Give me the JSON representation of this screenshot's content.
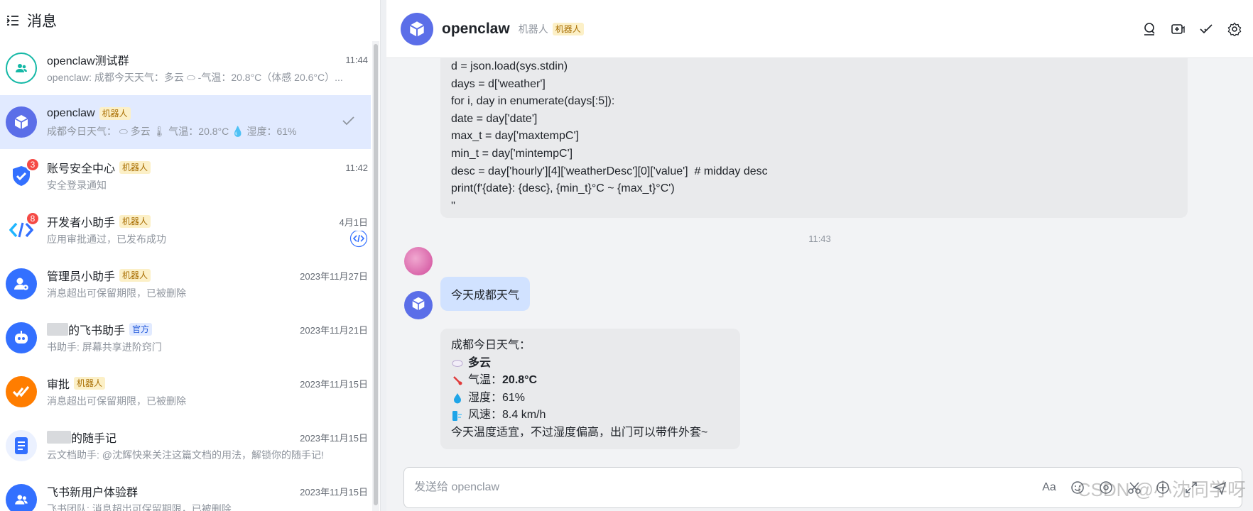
{
  "sidebar": {
    "title": "消息",
    "chats": [
      {
        "name": "openclaw测试群",
        "time": "11:44",
        "preview": "openclaw: 成都今天天气：多云 ⬭ -气温：20.8°C（体感 20.6°C）...",
        "avatar_color": "#14b8a6",
        "icon": "group-icon"
      },
      {
        "name": "openclaw",
        "tag": "机器人",
        "preview": "成都今日天气： ⬭ 多云 🌡 气温：20.8°C 💧 湿度：61%",
        "avatar_color": "#5b6ee8",
        "icon": "cube-icon",
        "active": true
      },
      {
        "name": "账号安全中心",
        "tag": "机器人",
        "time": "11:42",
        "preview": "安全登录通知",
        "badge": "3",
        "avatar_color": "#3370ff",
        "icon": "shield-icon"
      },
      {
        "name": "开发者小助手",
        "tag": "机器人",
        "time": "4月1日",
        "preview": "应用审批通过，已发布成功",
        "badge": "8",
        "avatar_color": "#ffffff",
        "icon": "code-icon"
      },
      {
        "name": "管理员小助手",
        "tag": "机器人",
        "time": "2023年11月27日",
        "preview": "消息超出可保留期限，已被删除",
        "avatar_color": "#3370ff",
        "icon": "admin-icon"
      },
      {
        "name": "的飞书助手",
        "tag": "官方",
        "time": "2023年11月21日",
        "preview": "书助手: 屏幕共享进阶窍门",
        "avatar_color": "#3370ff",
        "icon": "robot-icon"
      },
      {
        "name": "审批",
        "tag": "机器人",
        "time": "2023年11月15日",
        "preview": "消息超出可保留期限，已被删除",
        "avatar_color": "#ff7d00",
        "icon": "approval-icon"
      },
      {
        "name": "的随手记",
        "time": "2023年11月15日",
        "preview": "云文档助手: @沈辉快来关注这篇文档的用法，解锁你的随手记!",
        "avatar_color": "#ebf1ff",
        "icon": "doc-icon"
      },
      {
        "name": "飞书新用户体验群",
        "time": "2023年11月15日",
        "preview": "飞书团队: 消息超出可保留期限，已被删除",
        "avatar_color": "#3370ff",
        "icon": "group-icon"
      }
    ]
  },
  "header": {
    "title": "openclaw",
    "subtitle": "机器人",
    "tag": "机器人"
  },
  "messages": {
    "code_lines": [
      "d = json.load(sys.stdin)",
      "days = d['weather']",
      "for i, day in enumerate(days[:5]):",
      "date = day['date']",
      "max_t = day['maxtempC']",
      "min_t = day['mintempC']",
      "desc = day['hourly'][4]['weatherDesc'][0]['value']  # midday desc",
      "print(f'{date}: {desc}, {min_t}°C ~ {max_t}°C')",
      "''"
    ],
    "timestamp": "11:43",
    "user_message": "今天成都天气",
    "bot_reply": {
      "line1": "成都今日天气：",
      "line2": "多云",
      "temp_label": "气温：",
      "temp_value": "20.8°C",
      "humidity": "湿度：61%",
      "wind": "风速：8.4 km/h",
      "summary": "今天温度适宜，不过湿度偏高，出门可以带件外套~"
    }
  },
  "composer": {
    "placeholder": "发送给 openclaw",
    "font_label": "Aa"
  },
  "watermark": "CSDN @小沈同学呀",
  "colors": {
    "accent": "#3370ff",
    "active_row": "#e1eaff",
    "bot_tag_bg": "#fcf0c7",
    "badge": "#f54a45"
  }
}
